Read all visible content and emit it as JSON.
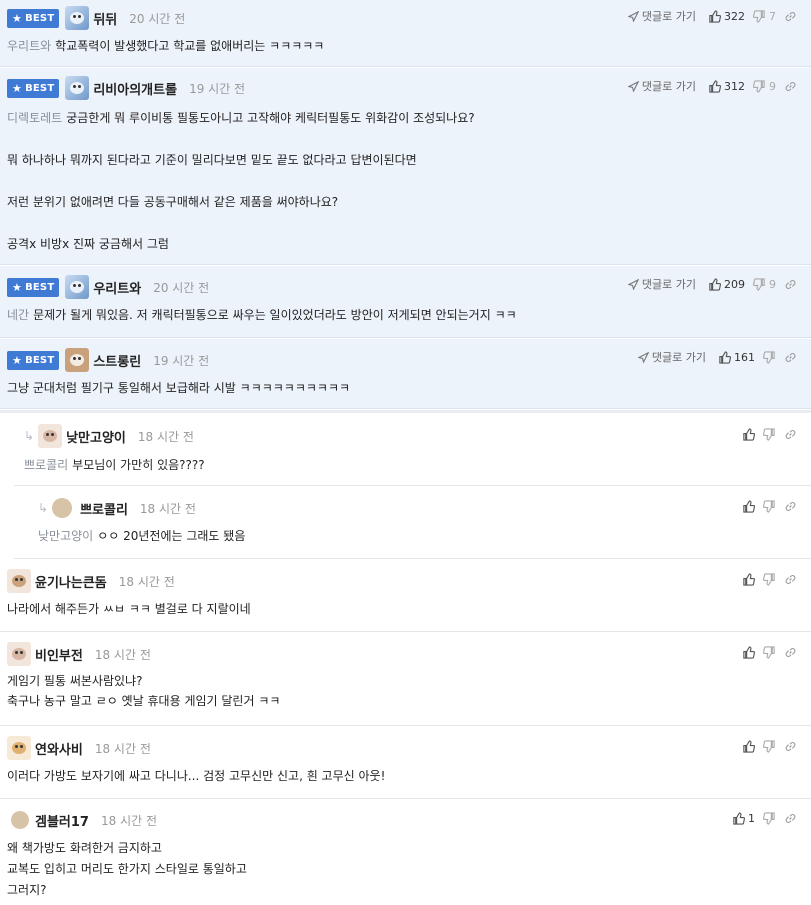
{
  "labels": {
    "best": "BEST",
    "reply_link": "댓글로 가기"
  },
  "comments": [
    {
      "nick": "뒤뒤",
      "time": "20 시간 전",
      "mention": "우리트와",
      "likes": "322",
      "dislikes": "7",
      "lines": [
        "학교폭력이 발생했다고 학교를 없애버리는 ㅋㅋㅋㅋㅋ"
      ]
    },
    {
      "nick": "리비아의개트롤",
      "time": "19 시간 전",
      "mention": "디렉토레트",
      "likes": "312",
      "dislikes": "9",
      "lines": [
        "궁금한게 뭐 루이비통 필통도아니고 고작해야 케릭터필통도 위화감이 조성되나요?",
        "뭐 하나하나 뭐까지 된다라고 기준이 밀리다보면 밑도 끝도 없다라고 답변이된다면",
        "저런 분위기 없애려면 다들 공동구매해서 같은 제품을 써야하나요?",
        "공격x 비방x 진짜 궁금해서 그럼"
      ]
    },
    {
      "nick": "우리트와",
      "time": "20 시간 전",
      "mention": "네간",
      "likes": "209",
      "dislikes": "9",
      "lines": [
        "문제가 될게 뭐있음. 저 캐릭터필통으로 싸우는 일이있었더라도 방안이 저게되면 안되는거지 ㅋㅋ"
      ]
    },
    {
      "nick": "스트롱린",
      "time": "19 시간 전",
      "mention": "",
      "likes": "161",
      "dislikes": "",
      "lines": [
        "그냥 군대처럼 필기구 통일해서 보급해라 시발 ㅋㅋㅋㅋㅋㅋㅋㅋㅋㅋ"
      ]
    },
    {
      "nick": "낮만고양이",
      "time": "18 시간 전",
      "mention": "쁘로콜리",
      "lines": [
        "부모님이 가만히 있음????"
      ]
    },
    {
      "nick": "쁘로콜리",
      "time": "18 시간 전",
      "mention": "낮만고양이",
      "lines": [
        "ㅇㅇ 20년전에는 그래도 됐음"
      ]
    },
    {
      "nick": "윤기나는큰돔",
      "time": "18 시간 전",
      "mention": "",
      "lines": [
        "나라에서 해주든가 ㅆㅂ ㅋㅋ 별걸로 다 지랄이네"
      ]
    },
    {
      "nick": "비인부전",
      "time": "18 시간 전",
      "mention": "",
      "lines": [
        "게임기 필통 써본사람있냐?",
        "축구나 농구 말고 ㄹㅇ 옛날 휴대용 게임기 달린거 ㅋㅋ"
      ]
    },
    {
      "nick": "연와사비",
      "time": "18 시간 전",
      "mention": "",
      "lines": [
        "이러다 가방도 보자기에 싸고 다니나... 검정 고무신만 신고, 흰 고무신 아웃!"
      ]
    },
    {
      "nick": "겜블러17",
      "time": "18 시간 전",
      "mention": "",
      "likes": "1",
      "lines": [
        "왜 책가방도 화려한거 금지하고",
        "교복도 입히고 머리도 한가지 스타일로 통일하고",
        "그러지?"
      ]
    }
  ],
  "colors": {
    "best_bg": "#edf3fb",
    "badge": "#3f7ad5",
    "mention": "#8a9099"
  },
  "icons": [
    "star-icon",
    "send-icon",
    "thumb-up-icon",
    "thumb-down-icon",
    "link-icon",
    "reply-arrow-icon"
  ]
}
